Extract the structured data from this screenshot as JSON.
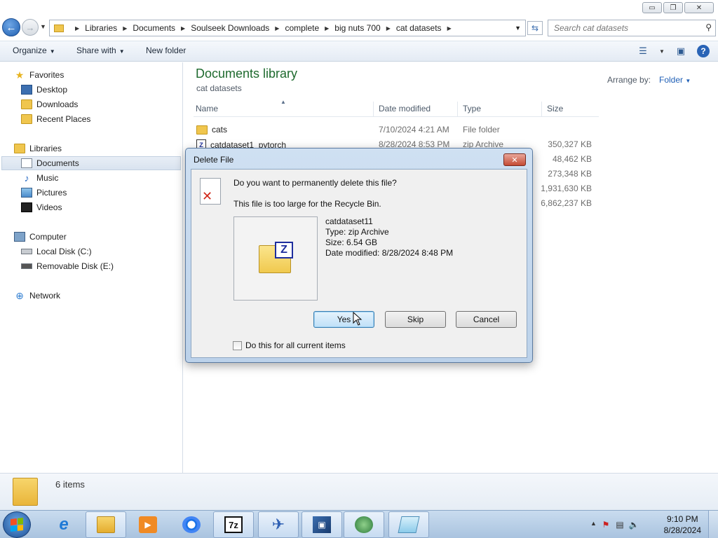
{
  "window": {
    "buttons": {
      "minimize": "▭",
      "maximize": "❐",
      "close": "✕"
    }
  },
  "address_bar": {
    "crumbs": [
      "Libraries",
      "Documents",
      "Soulseek Downloads",
      "complete",
      "big nuts 700",
      "cat datasets"
    ],
    "search_placeholder": "Search cat datasets"
  },
  "toolbar": {
    "organize": "Organize",
    "share_with": "Share with",
    "new_folder": "New folder"
  },
  "nav_pane": {
    "favorites": {
      "label": "Favorites",
      "items": [
        "Desktop",
        "Downloads",
        "Recent Places"
      ]
    },
    "libraries": {
      "label": "Libraries",
      "items": [
        "Documents",
        "Music",
        "Pictures",
        "Videos"
      ]
    },
    "computer": {
      "label": "Computer",
      "items": [
        "Local Disk (C:)",
        "Removable Disk (E:)"
      ]
    },
    "network": {
      "label": "Network"
    }
  },
  "content": {
    "title": "Documents library",
    "subtitle": "cat datasets",
    "arrange_label": "Arrange by:",
    "arrange_value": "Folder",
    "columns": [
      "Name",
      "Date modified",
      "Type",
      "Size"
    ],
    "rows": [
      {
        "name": "cats",
        "date": "7/10/2024 4:21 AM",
        "type": "File folder",
        "size": ""
      },
      {
        "name": "catdataset1_pytorch",
        "date": "8/28/2024 8:53 PM",
        "type": "zip Archive",
        "size": "350,327 KB"
      },
      {
        "name": "",
        "date": "",
        "type": "",
        "size": "48,462 KB"
      },
      {
        "name": "",
        "date": "",
        "type": "",
        "size": "273,348 KB"
      },
      {
        "name": "",
        "date": "",
        "type": "",
        "size": "1,931,630 KB"
      },
      {
        "name": "",
        "date": "",
        "type": "",
        "size": "6,862,237 KB"
      }
    ]
  },
  "status": {
    "items_count": "6 items"
  },
  "dialog": {
    "title": "Delete File",
    "question": "Do you want to permanently delete this file?",
    "reason": "This file is too large for the Recycle Bin.",
    "file": {
      "name": "catdataset11",
      "type": "Type: zip Archive",
      "size": "Size: 6.54 GB",
      "date": "Date modified: 8/28/2024 8:48 PM"
    },
    "buttons": {
      "yes": "Yes",
      "skip": "Skip",
      "cancel": "Cancel"
    },
    "checkbox_label": "Do this for all current items"
  },
  "taskbar": {
    "clock_time": "9:10 PM",
    "clock_date": "8/28/2024"
  }
}
